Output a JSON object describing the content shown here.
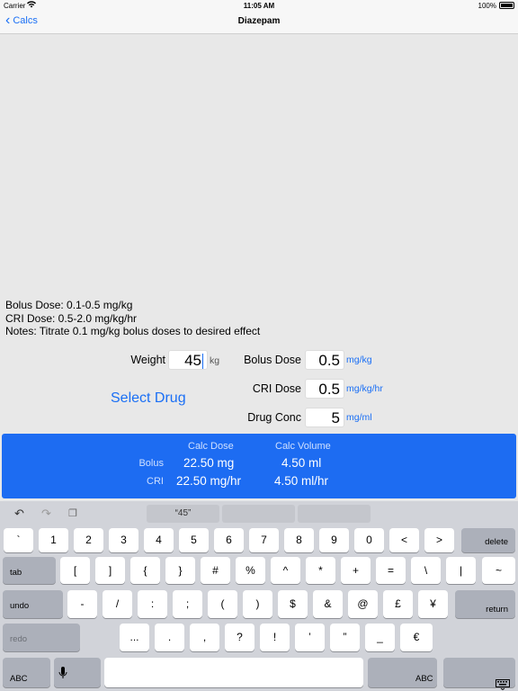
{
  "status": {
    "carrier": "Carrier",
    "time": "11:05 AM",
    "battery": "100%"
  },
  "nav": {
    "back_label": "Calcs",
    "title": "Diazepam"
  },
  "info": {
    "bolus": "Bolus Dose: 0.1-0.5 mg/kg",
    "cri": "CRI Dose: 0.5-2.0 mg/kg/hr",
    "notes": "Notes: Titrate 0.1 mg/kg bolus doses to desired effect"
  },
  "form": {
    "weight_label": "Weight",
    "weight_value": "45",
    "weight_unit": "kg",
    "bolus_label": "Bolus Dose",
    "bolus_value": "0.5",
    "bolus_unit": "mg/kg",
    "cri_label": "CRI Dose",
    "cri_value": "0.5",
    "cri_unit": "mg/kg/hr",
    "conc_label": "Drug Conc",
    "conc_value": "5",
    "conc_unit": "mg/ml",
    "select_drug": "Select Drug"
  },
  "results": {
    "hdr_dose": "Calc Dose",
    "hdr_volume": "Calc Volume",
    "bolus_label": "Bolus",
    "bolus_dose": "22.50 mg",
    "bolus_volume": "4.50 ml",
    "cri_label": "CRI",
    "cri_dose": "22.50 mg/hr",
    "cri_volume": "4.50 ml/hr"
  },
  "keyboard": {
    "prediction": "“45”",
    "row1": [
      "`",
      "1",
      "2",
      "3",
      "4",
      "5",
      "6",
      "7",
      "8",
      "9",
      "0",
      "<",
      ">"
    ],
    "row1_fn": "delete",
    "row2_fn": "tab",
    "row2": [
      "[",
      "]",
      "{",
      "}",
      "#",
      "%",
      "^",
      "*",
      "+",
      "=",
      "\\",
      "|",
      "~"
    ],
    "row3_fn": "undo",
    "row3": [
      "-",
      "/",
      ":",
      ";",
      "(",
      ")",
      "$",
      "&",
      "@",
      "£",
      "¥"
    ],
    "row3_fn_right": "return",
    "row4_fn": "redo",
    "row4": [
      "...",
      ".",
      ",",
      "?",
      "!",
      "’",
      "”",
      "_",
      "€"
    ],
    "row5_left": "ABC",
    "row5_right": "ABC"
  }
}
